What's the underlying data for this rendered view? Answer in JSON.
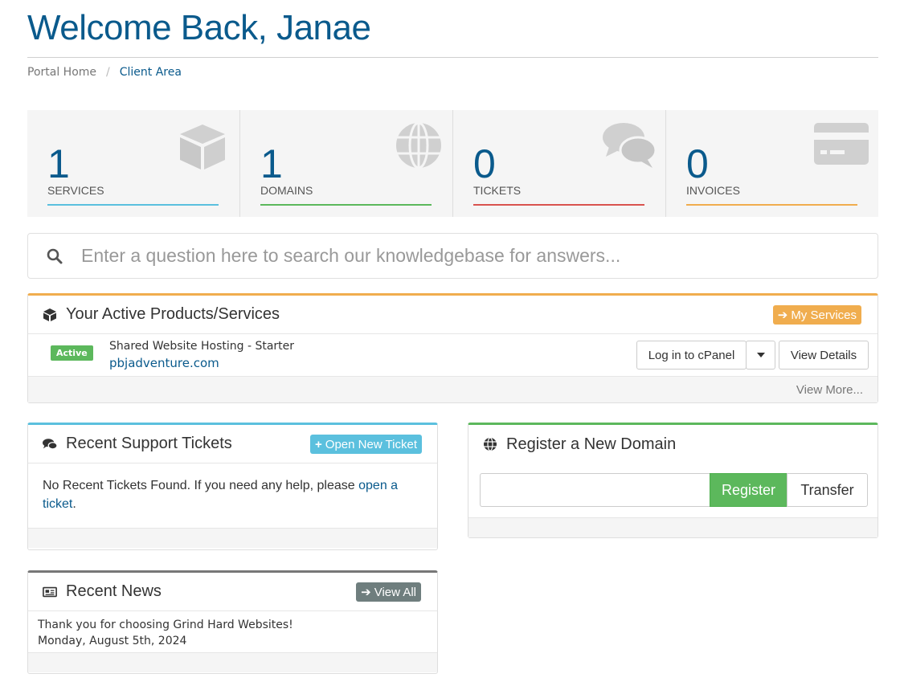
{
  "page_title": "Welcome Back, Janae",
  "breadcrumb": {
    "home": "Portal Home",
    "separator": "/",
    "current": "Client Area"
  },
  "tiles": [
    {
      "count": "1",
      "label": "Services",
      "icon": "cube-icon",
      "color": "#5bc0de"
    },
    {
      "count": "1",
      "label": "Domains",
      "icon": "globe-icon",
      "color": "#5cb85c"
    },
    {
      "count": "0",
      "label": "Tickets",
      "icon": "comments-icon",
      "color": "#d9534f"
    },
    {
      "count": "0",
      "label": "Invoices",
      "icon": "credit-card-icon",
      "color": "#f0ad4e"
    }
  ],
  "kb_search": {
    "placeholder": "Enter a question here to search our knowledgebase for answers...",
    "icon": "search-icon"
  },
  "active_products": {
    "title": "Your Active Products/Services",
    "header_button": "My Services",
    "accent": "#f0ad4e",
    "items": [
      {
        "status": "Active",
        "name": "Shared Website Hosting - Starter",
        "domain": "pbjadventure.com",
        "login_label": "Log in to cPanel",
        "details_label": "View Details"
      }
    ],
    "view_more": "View More..."
  },
  "support_tickets": {
    "title": "Recent Support Tickets",
    "header_button": "Open New Ticket",
    "accent": "#5bc0de",
    "body_text": "No Recent Tickets Found. If you need any help, please ",
    "link_text": "open a ticket",
    "body_end": "."
  },
  "register_domain": {
    "title": "Register a New Domain",
    "register_label": "Register",
    "transfer_label": "Transfer",
    "accent": "#5cb85c"
  },
  "recent_news": {
    "title": "Recent News",
    "header_button": "View All",
    "accent": "#777777",
    "items": [
      {
        "headline": "Thank you for choosing Grind Hard Websites!",
        "date": "Monday, August 5th, 2024"
      }
    ]
  }
}
